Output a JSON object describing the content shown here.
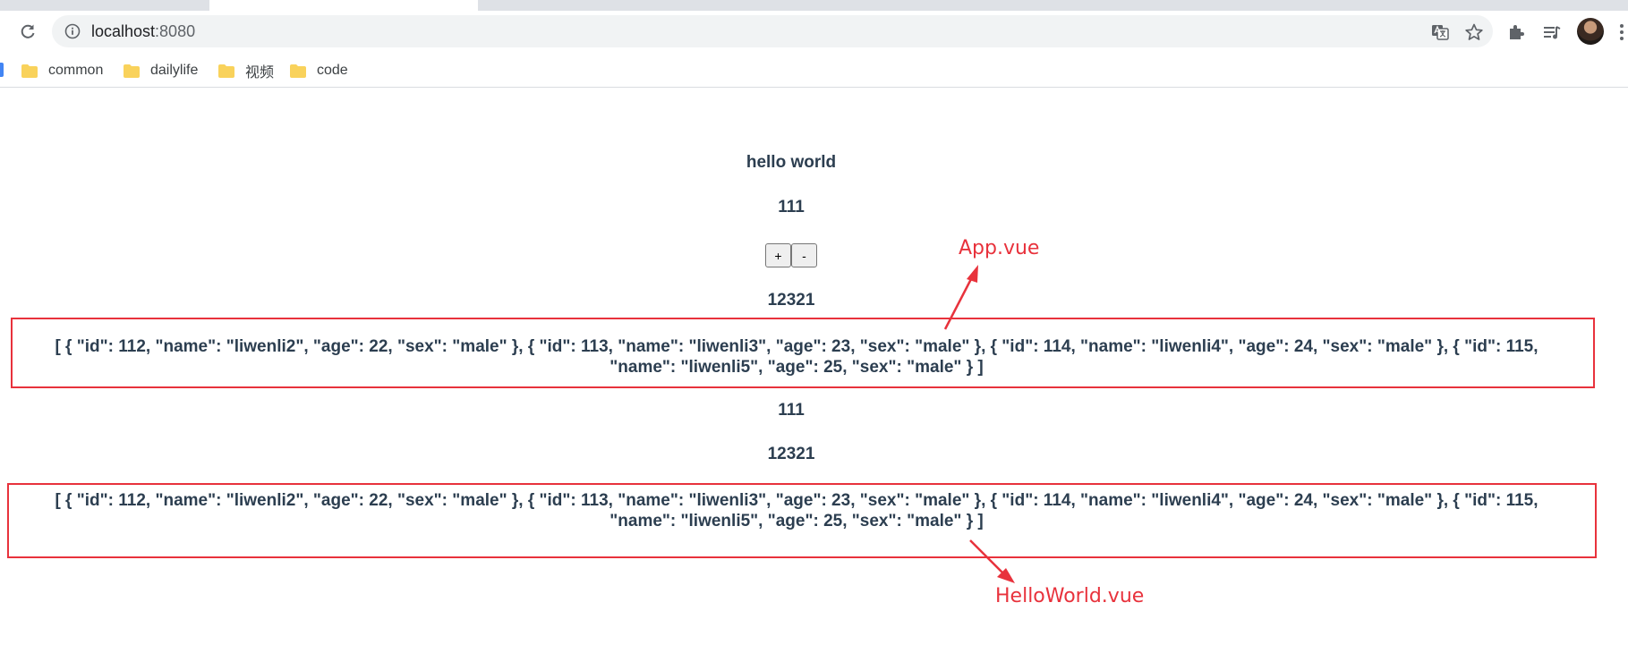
{
  "browser": {
    "url_host": "localhost",
    "url_port": ":8080",
    "bookmarks": [
      {
        "label": "common"
      },
      {
        "label": "dailylife"
      },
      {
        "label": "视频"
      },
      {
        "label": "code"
      }
    ],
    "icons": {
      "reload": "reload-icon",
      "info": "info-icon",
      "translate": "translate-icon",
      "star": "star-icon",
      "extensions": "puzzle-icon",
      "media": "media-queue-icon",
      "avatar": "avatar",
      "menu": "kebab-menu-icon"
    }
  },
  "page": {
    "title": "hello world",
    "counter_top": "111",
    "plus_label": "+",
    "minus_label": "-",
    "number_top": "12321",
    "json_top_line1": "[ { \"id\": 112, \"name\": \"liwenli2\", \"age\": 22, \"sex\": \"male\" }, { \"id\": 113, \"name\": \"liwenli3\", \"age\": 23, \"sex\": \"male\" }, { \"id\": 114, \"name\": \"liwenli4\", \"age\": 24, \"sex\": \"male\" }, { \"id\": 115,",
    "json_top_line2": "\"name\": \"liwenli5\", \"age\": 25, \"sex\": \"male\" } ]",
    "counter_bottom": "111",
    "number_bottom": "12321",
    "json_bottom_line1": "[ { \"id\": 112, \"name\": \"liwenli2\", \"age\": 22, \"sex\": \"male\" }, { \"id\": 113, \"name\": \"liwenli3\", \"age\": 23, \"sex\": \"male\" }, { \"id\": 114, \"name\": \"liwenli4\", \"age\": 24, \"sex\": \"male\" }, { \"id\": 115,",
    "json_bottom_line2": "\"name\": \"liwenli5\", \"age\": 25, \"sex\": \"male\" } ]"
  },
  "annotations": {
    "app_label": "App.vue",
    "helloworld_label": "HelloWorld.vue",
    "color": "#e8323c"
  },
  "colors": {
    "text": "#2c3e50",
    "chrome_bg": "#dee1e6",
    "omnibox_bg": "#f1f3f4",
    "folder": "#f9d25b"
  }
}
